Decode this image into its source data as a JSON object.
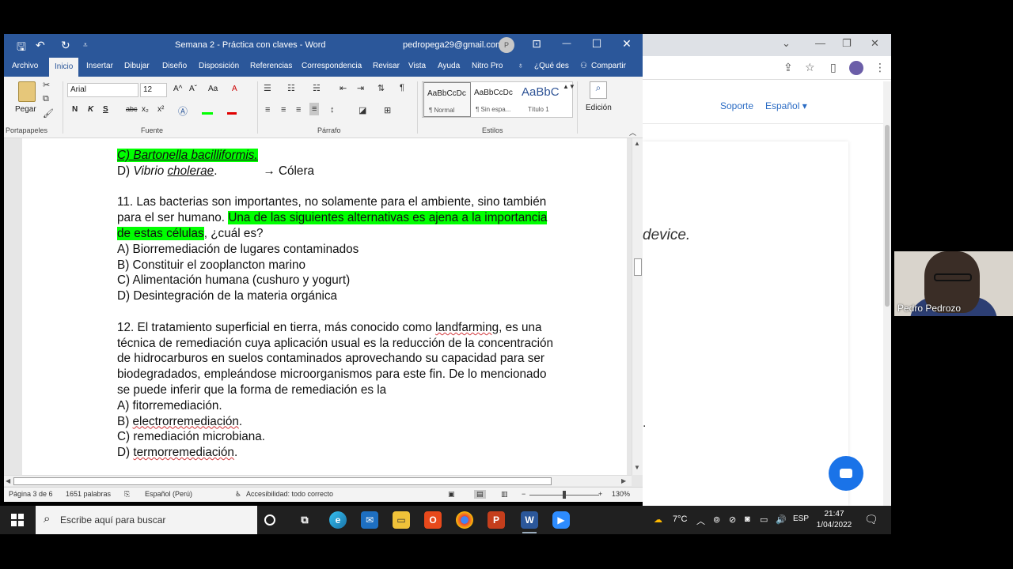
{
  "word": {
    "quick_access": {
      "save": "🖫",
      "undo": "↶",
      "redo": "↻",
      "customize": "⩡"
    },
    "title": "Semana 2 - Práctica con claves - Word",
    "account_email": "pedropega29@gmail.com",
    "avatar_initial": "P",
    "window_buttons": {
      "ribbon_options": "⊡",
      "minimize": "—",
      "maximize": "☐",
      "close": "✕"
    },
    "tabs": [
      "Archivo",
      "Inicio",
      "Insertar",
      "Dibujar",
      "Diseño",
      "Disposición",
      "Referencias",
      "Correspondencia",
      "Revisar",
      "Vista",
      "Ayuda",
      "Nitro Pro"
    ],
    "tell_me": "¿Qué des",
    "share": "Compartir",
    "ribbon": {
      "paste_label": "Pegar",
      "font_name": "Arial",
      "font_size": "12",
      "font_grow": "A^",
      "font_shrink": "Aˇ",
      "change_case": "Aa",
      "clear_format": "A",
      "bold": "N",
      "italic": "K",
      "underline": "S",
      "strike": "abc",
      "subscript": "x₂",
      "superscript": "x²",
      "groups": [
        "Portapapeles",
        "Fuente",
        "Párrafo",
        "Estilos"
      ],
      "styles": [
        {
          "sample": "AaBbCcDc",
          "name": "¶ Normal"
        },
        {
          "sample": "AaBbCcDc",
          "name": "¶ Sin espa..."
        },
        {
          "sample": "AaBbC",
          "name": "Título 1"
        }
      ],
      "edit_label": "Edición"
    },
    "doc": {
      "q10c": "C) Bartonella bacilliformis.",
      "q10d_pre": "D) ",
      "q10d_italic_a": "Vibrio",
      "q10d_italic_b": "cholerae",
      "q10d_post": ".",
      "q10d_arrow": "→ Cólera",
      "q11_line1": "11. Las bacterias son importantes, no solamente para el ambiente, sino también",
      "q11_line2_plain": "para el ser humano. ",
      "q11_line2_hl": "Una de las siguientes alternativas es ajena a la importancia",
      "q11_line3_hl": "de estas células",
      "q11_line3_plain": ", ¿cuál es?",
      "q11_a": "A) Biorremediación de lugares contaminados",
      "q11_b": "B) Constituir el zooplancton marino",
      "q11_c": "C) Alimentación humana (cushuro y yogurt)",
      "q11_d": "D) Desintegración de la materia orgánica",
      "q12_line1_pre": "12. El tratamiento superficial en tierra, más conocido como ",
      "q12_line1_sq": "landfarming",
      "q12_line1_post": ", es una",
      "q12_line2": "técnica de remediación cuya aplicación usual es la reducción de la concentración",
      "q12_line3": "de hidrocarburos en suelos contaminados aprovechando su capacidad para ser",
      "q12_line4": "biodegradados, empleándose microorganismos para este fin. De lo mencionado",
      "q12_line5": "se puede inferir que la forma de remediación es la",
      "q12_a": "A) fitorremediación.",
      "q12_b_pre": "B) ",
      "q12_b_sq": "electrorremediación",
      "q12_b_post": ".",
      "q12_c": "C) remediación microbiana.",
      "q12_d_pre": "D) ",
      "q12_d_sq": "termorremediación",
      "q12_d_post": "."
    },
    "status": {
      "page": "Página 3 de 6",
      "words": "1651 palabras",
      "language": "Español (Perú)",
      "accessibility": "Accesibilidad: todo correcto",
      "zoom_minus": "−",
      "zoom_plus": "+",
      "zoom": "130%",
      "zoom_fraction": 0.5
    }
  },
  "browser": {
    "nav_support": "Soporte",
    "nav_language": "Español ▾",
    "content_fragment": "device.",
    "content_dot": "."
  },
  "webcam": {
    "name": "Pedro Pedrozo"
  },
  "taskbar": {
    "search_placeholder": "Escribe aquí para buscar",
    "temperature": "7°C",
    "language": "ESP",
    "time": "21:47",
    "date": "1/04/2022"
  },
  "colors": {
    "word_blue": "#2b579a",
    "highlight": "#00ff00",
    "taskbar": "#202020",
    "chat_blue": "#1a73e8"
  }
}
